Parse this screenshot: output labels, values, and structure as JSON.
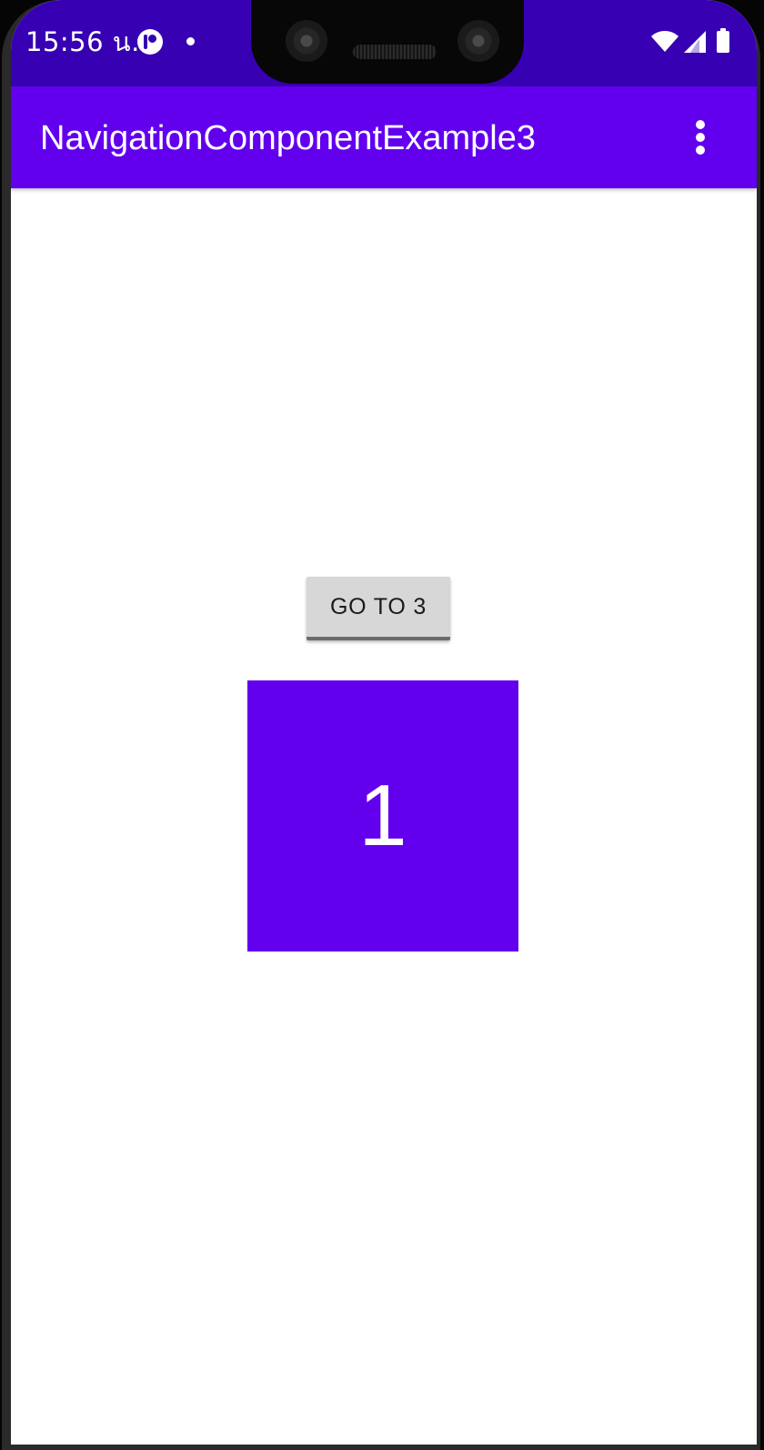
{
  "status_bar": {
    "time": "15:56 น.",
    "icons": [
      "app-notification-icon",
      "dot-icon",
      "wifi-icon",
      "signal-icon",
      "battery-icon"
    ]
  },
  "app_bar": {
    "title": "NavigationComponentExample3",
    "menu_icon": "more-vert-icon"
  },
  "main": {
    "button_label": "GO TO 3",
    "box_text": "1"
  },
  "colors": {
    "status_bar": "#3700B3",
    "primary": "#6200EE",
    "button": "#D7D7D7",
    "background": "#FFFFFF"
  }
}
